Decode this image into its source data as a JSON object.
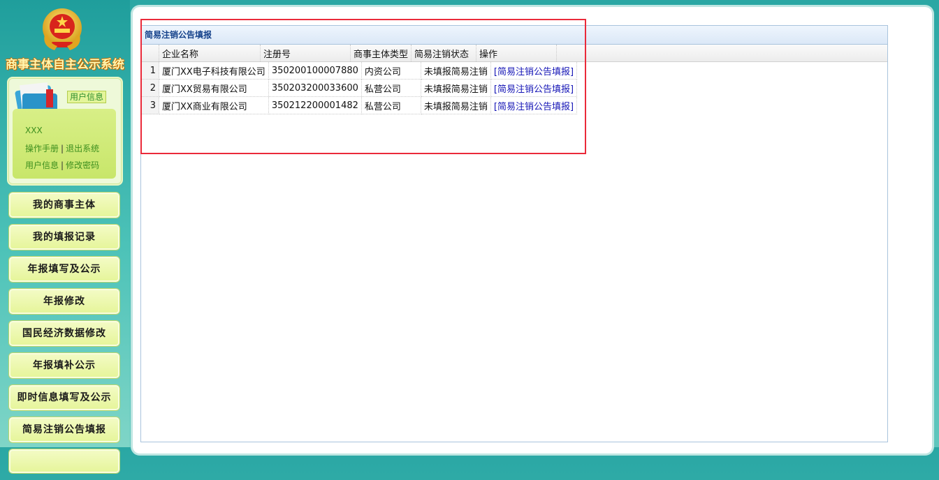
{
  "app": {
    "system_title": "商事主体自主公示系统"
  },
  "user_panel": {
    "badge": "用户信息",
    "username": "XXX",
    "link_manual": "操作手册",
    "link_logout": "退出系统",
    "link_userinfo": "用户信息",
    "link_password": "修改密码",
    "separator": "|"
  },
  "menu": {
    "items": [
      {
        "label": "我的商事主体"
      },
      {
        "label": "我的填报记录"
      },
      {
        "label": "年报填写及公示"
      },
      {
        "label": "年报修改"
      },
      {
        "label": "国民经济数据修改"
      },
      {
        "label": "年报填补公示"
      },
      {
        "label": "即时信息填写及公示"
      },
      {
        "label": "简易注销公告填报"
      }
    ]
  },
  "panel": {
    "title": "简易注销公告填报",
    "columns": [
      "企业名称",
      "注册号",
      "商事主体类型",
      "简易注销状态",
      "操作"
    ],
    "rows": [
      {
        "index": "1",
        "name": "厦门XX电子科技有限公司",
        "reg_no": "350200100007880",
        "type": "内资公司",
        "status": "未填报简易注销",
        "action": "[简易注销公告填报]"
      },
      {
        "index": "2",
        "name": "厦门XX贸易有限公司",
        "reg_no": "350203200033600",
        "type": "私营公司",
        "status": "未填报简易注销",
        "action": "[简易注销公告填报]"
      },
      {
        "index": "3",
        "name": "厦门XX商业有限公司",
        "reg_no": "350212200001482",
        "type": "私营公司",
        "status": "未填报简易注销",
        "action": "[简易注销公告填报]"
      }
    ]
  },
  "colors": {
    "accent_teal": "#2aa7a4",
    "menu_green": "#e6f59b",
    "link_blue": "#1515b6",
    "highlight_red": "#ea2a3a"
  }
}
